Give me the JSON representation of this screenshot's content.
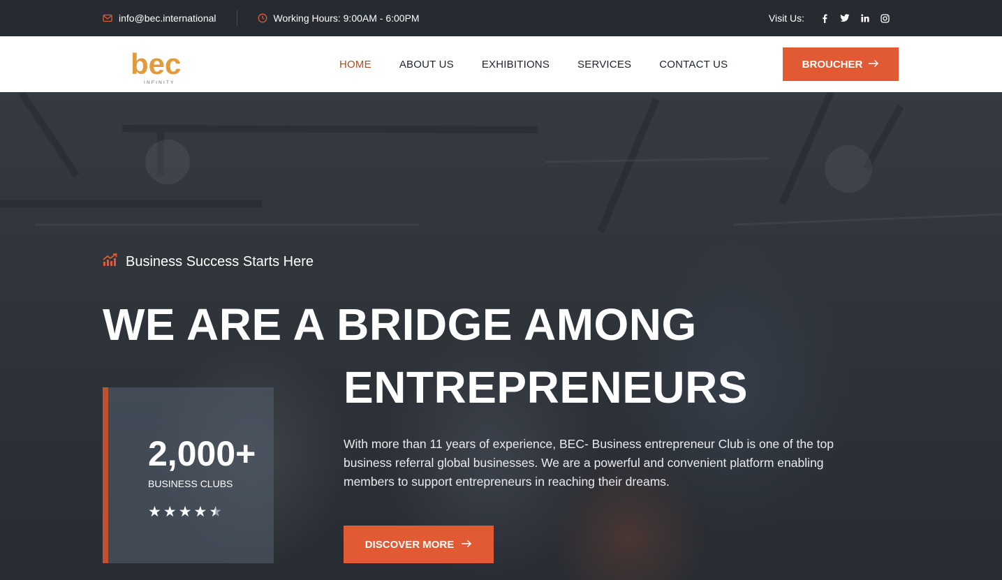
{
  "topbar": {
    "email": "info@bec.international",
    "hours": "Working Hours: 9:00AM - 6:00PM",
    "visit_label": "Visit Us:",
    "socials": [
      "facebook-icon",
      "twitter-icon",
      "linkedin-icon",
      "instagram-icon"
    ]
  },
  "nav": {
    "logo_text": "bec",
    "logo_sub": "INFINITY",
    "links": [
      {
        "label": "HOME",
        "active": true
      },
      {
        "label": "ABOUT US",
        "active": false
      },
      {
        "label": "EXHIBITIONS",
        "active": false
      },
      {
        "label": "SERVICES",
        "active": false
      },
      {
        "label": "CONTACT US",
        "active": false
      }
    ],
    "cta": "BROUCHER"
  },
  "hero": {
    "tagline": "Business Success Starts Here",
    "headline_line1": "WE ARE A BRIDGE AMONG",
    "headline_line2": "ENTREPRENEURS",
    "stat_value": "2,000+",
    "stat_label": "BUSINESS CLUBS",
    "rating": 4.5,
    "description": "With more than 11 years of experience, BEC- Business entrepreneur Club is one of the top business referral global businesses. We are a powerful and convenient platform enabling members to support entrepreneurs in reaching their dreams.",
    "cta": "DISCOVER MORE"
  },
  "colors": {
    "accent": "#e25a33",
    "topbar_bg": "#262b32",
    "nav_active": "#b3461f",
    "logo_orange": "#e39a3b",
    "logo_slate": "#5d6b7e"
  }
}
